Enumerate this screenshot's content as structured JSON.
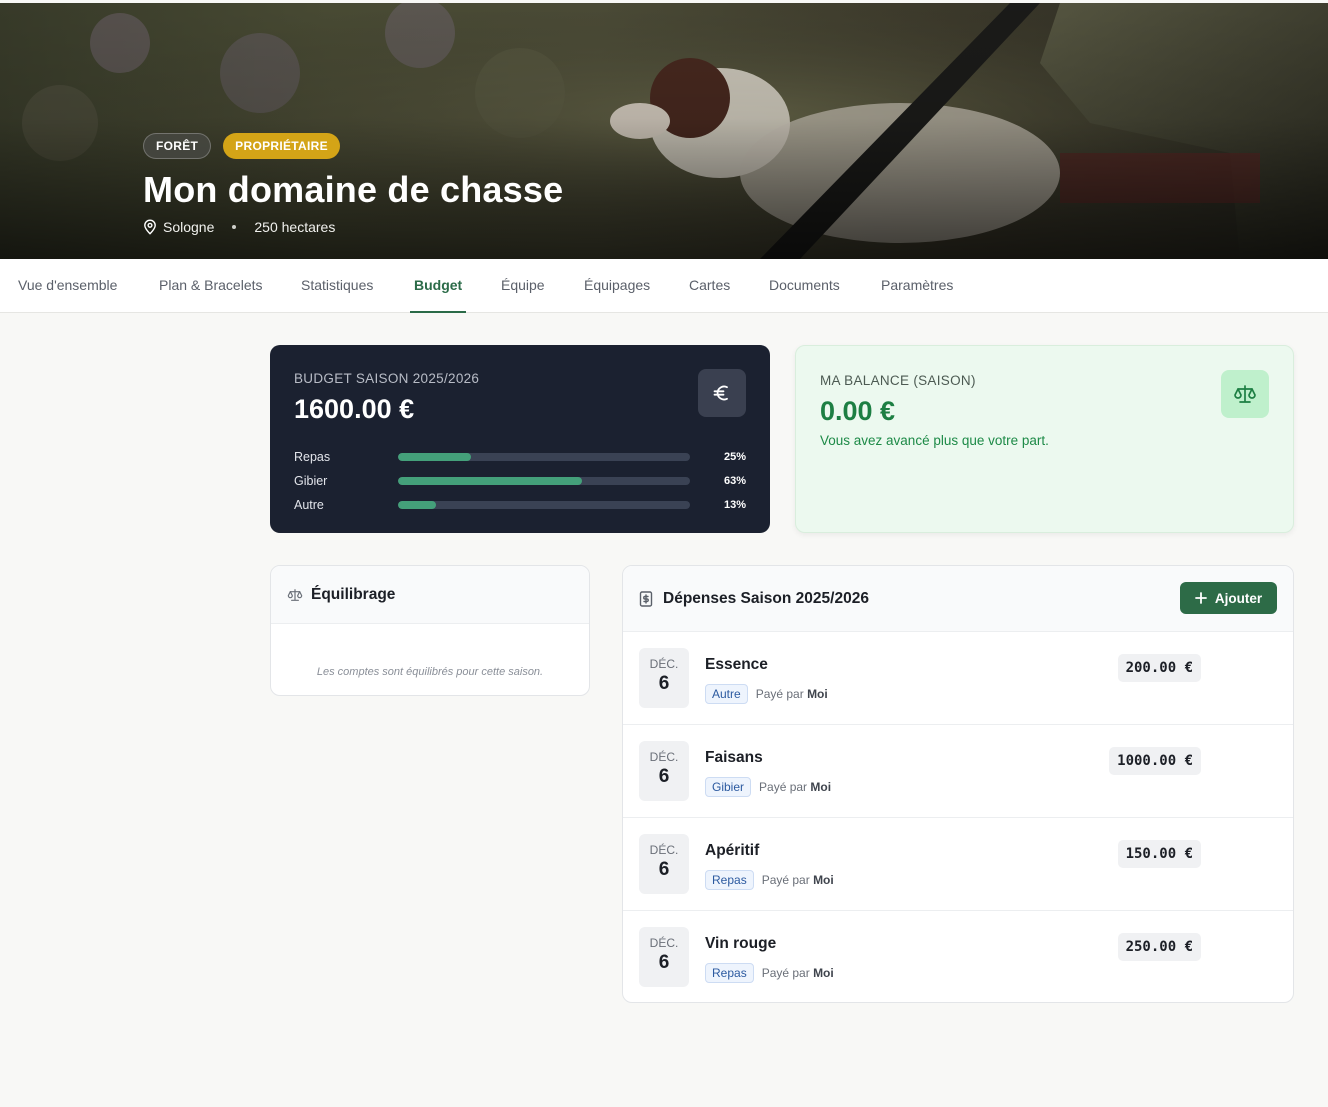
{
  "hero": {
    "tag_forest": "FORÊT",
    "tag_owner": "PROPRIÉTAIRE",
    "title": "Mon domaine de chasse",
    "location": "Sologne",
    "area": "250 hectares"
  },
  "tabs": [
    {
      "label": "Vue d'ensemble"
    },
    {
      "label": "Plan & Bracelets"
    },
    {
      "label": "Statistiques"
    },
    {
      "label": "Budget",
      "active": true
    },
    {
      "label": "Équipe"
    },
    {
      "label": "Équipages"
    },
    {
      "label": "Cartes"
    },
    {
      "label": "Documents"
    },
    {
      "label": "Paramètres"
    }
  ],
  "budget": {
    "label": "BUDGET SAISON 2025/2026",
    "amount": "1600.00 €",
    "icon": "euro-icon",
    "rows": [
      {
        "label": "Repas",
        "pct": "25%",
        "value": 25
      },
      {
        "label": "Gibier",
        "pct": "63%",
        "value": 63
      },
      {
        "label": "Autre",
        "pct": "13%",
        "value": 13
      }
    ]
  },
  "balance": {
    "label": "MA BALANCE (SAISON)",
    "amount": "0.00 €",
    "note": "Vous avez avancé plus que votre part.",
    "icon": "scale-icon"
  },
  "equilibrage": {
    "title": "Équilibrage",
    "empty": "Les comptes sont équilibrés pour cette saison."
  },
  "expenses": {
    "title": "Dépenses Saison 2025/2026",
    "add_label": "Ajouter",
    "paid_by_prefix": "Payé par",
    "items": [
      {
        "month": "DÉC.",
        "day": "6",
        "name": "Essence",
        "category": "Autre",
        "payer": "Moi",
        "amount": "200.00 €"
      },
      {
        "month": "DÉC.",
        "day": "6",
        "name": "Faisans",
        "category": "Gibier",
        "payer": "Moi",
        "amount": "1000.00 €"
      },
      {
        "month": "DÉC.",
        "day": "6",
        "name": "Apéritif",
        "category": "Repas",
        "payer": "Moi",
        "amount": "150.00 €"
      },
      {
        "month": "DÉC.",
        "day": "6",
        "name": "Vin rouge",
        "category": "Repas",
        "payer": "Moi",
        "amount": "250.00 €"
      }
    ]
  },
  "colors": {
    "accent_green": "#2d6b47",
    "budget_bg": "#1b2130",
    "balance_bg": "#ecf9ef",
    "tag_owner": "#d4a417"
  }
}
